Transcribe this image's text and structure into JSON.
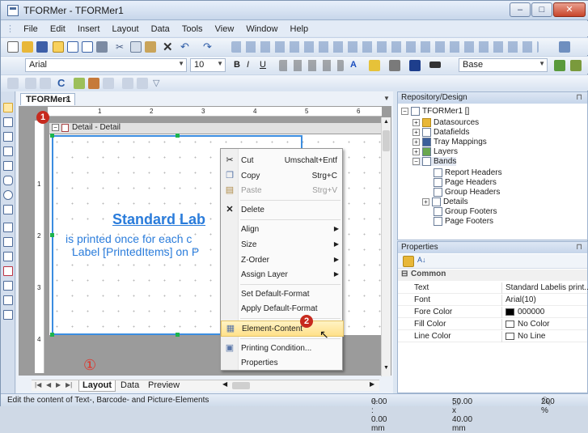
{
  "window": {
    "title": "TFORMer - TFORMer1"
  },
  "menu": [
    "File",
    "Edit",
    "Insert",
    "Layout",
    "Data",
    "Tools",
    "View",
    "Window",
    "Help"
  ],
  "format_bar": {
    "font": "Arial",
    "size": "10",
    "style": "Base"
  },
  "doc_tab": {
    "label": "TFORMer1",
    "close": "×"
  },
  "ruler": {
    "h": [
      "1",
      "2",
      "3",
      "4",
      "5",
      "6"
    ],
    "v": [
      "1",
      "2",
      "3",
      "4"
    ]
  },
  "band": {
    "header": "Detail - Detail",
    "collapse": "−"
  },
  "canvas_text": {
    "title": "Standard Lab",
    "line1": "is printed once for each c",
    "line2": "Label [PrintedItems] on P"
  },
  "annotations": {
    "badge1": "1",
    "badge2": "2",
    "circled": "①"
  },
  "context_menu": [
    {
      "label": "Cut",
      "shortcut": "Umschalt+Entf",
      "icon": "cut-icon"
    },
    {
      "label": "Copy",
      "shortcut": "Strg+C",
      "icon": "copy-icon"
    },
    {
      "label": "Paste",
      "shortcut": "Strg+V",
      "icon": "paste-icon",
      "disabled": true
    },
    {
      "label": "Delete",
      "icon": "delete-icon"
    },
    {
      "label": "Align",
      "submenu": true
    },
    {
      "label": "Size",
      "submenu": true
    },
    {
      "label": "Z-Order",
      "submenu": true
    },
    {
      "label": "Assign Layer",
      "submenu": true
    },
    {
      "label": "Set Default-Format"
    },
    {
      "label": "Apply Default-Format"
    },
    {
      "label": "Element-Content",
      "icon": "element-content-icon",
      "highlighted": true
    },
    {
      "label": "Printing Condition...",
      "icon": "printing-condition-icon"
    },
    {
      "label": "Properties"
    }
  ],
  "bottom_tabs": [
    "Layout",
    "Data",
    "Preview"
  ],
  "repository": {
    "title": "Repository/Design",
    "pin": "⊓",
    "tree": [
      {
        "label": "TFORMer1 []",
        "level": 0,
        "expander": "−"
      },
      {
        "label": "Datasources",
        "level": 1,
        "expander": "+"
      },
      {
        "label": "Datafields",
        "level": 1,
        "expander": "+"
      },
      {
        "label": "Tray Mappings",
        "level": 1,
        "expander": "+"
      },
      {
        "label": "Layers",
        "level": 1,
        "expander": "+"
      },
      {
        "label": "Bands",
        "level": 1,
        "expander": "−"
      },
      {
        "label": "Report Headers",
        "level": 2
      },
      {
        "label": "Page Headers",
        "level": 2
      },
      {
        "label": "Group Headers",
        "level": 2
      },
      {
        "label": "Details",
        "level": 2,
        "expander": "+"
      },
      {
        "label": "Group Footers",
        "level": 2
      },
      {
        "label": "Page Footers",
        "level": 2
      }
    ]
  },
  "properties": {
    "title": "Properties",
    "pin": "⊓",
    "category": "Common",
    "rows": [
      {
        "key": "Text",
        "value": "Standard Labelis print..."
      },
      {
        "key": "Font",
        "value": "Arial(10)"
      },
      {
        "key": "Fore Color",
        "value": "000000",
        "swatch": "#000000"
      },
      {
        "key": "Fill Color",
        "value": "No Color",
        "swatch": "#ffffff"
      },
      {
        "key": "Line Color",
        "value": "No Line",
        "swatch": "#ffffff"
      }
    ]
  },
  "status": {
    "hint": "Edit the content of Text-, Barcode- and Picture-Elements",
    "position": "0.00 : 0.00 mm",
    "size": "50.00 x 40.00 mm",
    "zoom": "200 %"
  }
}
